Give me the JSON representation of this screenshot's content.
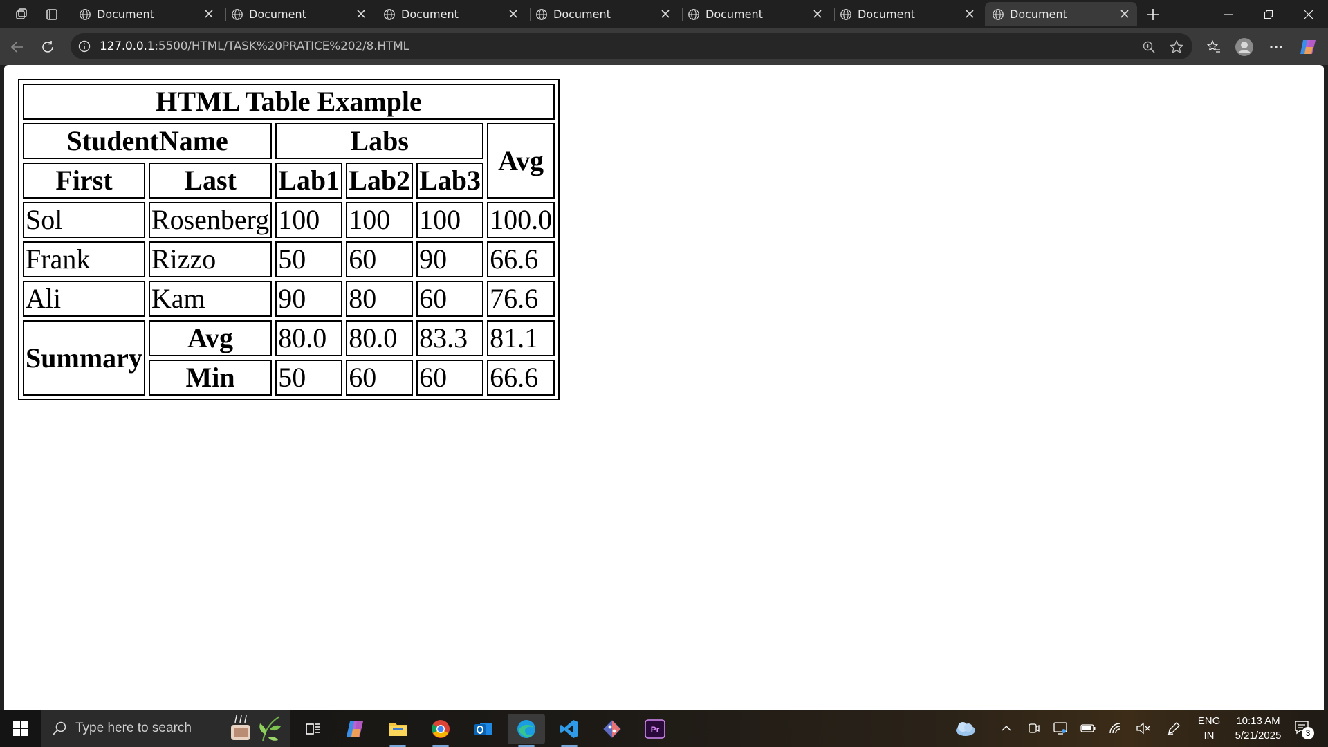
{
  "browser": {
    "tabs": [
      {
        "title": "Document",
        "active": false
      },
      {
        "title": "Document",
        "active": false
      },
      {
        "title": "Document",
        "active": false
      },
      {
        "title": "Document",
        "active": false
      },
      {
        "title": "Document",
        "active": false
      },
      {
        "title": "Document",
        "active": false
      },
      {
        "title": "Document",
        "active": true
      }
    ],
    "url_host": "127.0.0.1",
    "url_rest": ":5500/HTML/TASK%20PRATICE%202/8.HTML"
  },
  "table": {
    "caption": "HTML Table Example",
    "header": {
      "student_name": "StudentName",
      "labs": "Labs",
      "avg": "Avg",
      "first": "First",
      "last": "Last",
      "lab1": "Lab1",
      "lab2": "Lab2",
      "lab3": "Lab3"
    },
    "rows": [
      {
        "first": "Sol",
        "last": "Rosenberg",
        "lab1": "100",
        "lab2": "100",
        "lab3": "100",
        "avg": "100.0"
      },
      {
        "first": "Frank",
        "last": "Rizzo",
        "lab1": "50",
        "lab2": "60",
        "lab3": "90",
        "avg": "66.6"
      },
      {
        "first": "Ali",
        "last": "Kam",
        "lab1": "90",
        "lab2": "80",
        "lab3": "60",
        "avg": "76.6"
      }
    ],
    "summary": {
      "label": "Summary",
      "avg_label": "Avg",
      "avg": {
        "lab1": "80.0",
        "lab2": "80.0",
        "lab3": "83.3",
        "avg": "81.1"
      },
      "min_label": "Min",
      "min": {
        "lab1": "50",
        "lab2": "60",
        "lab3": "60",
        "avg": "66.6"
      }
    }
  },
  "taskbar": {
    "search_placeholder": "Type here to search",
    "language_line1": "ENG",
    "language_line2": "IN",
    "time": "10:13 AM",
    "date": "5/21/2025",
    "notification_count": "3"
  }
}
